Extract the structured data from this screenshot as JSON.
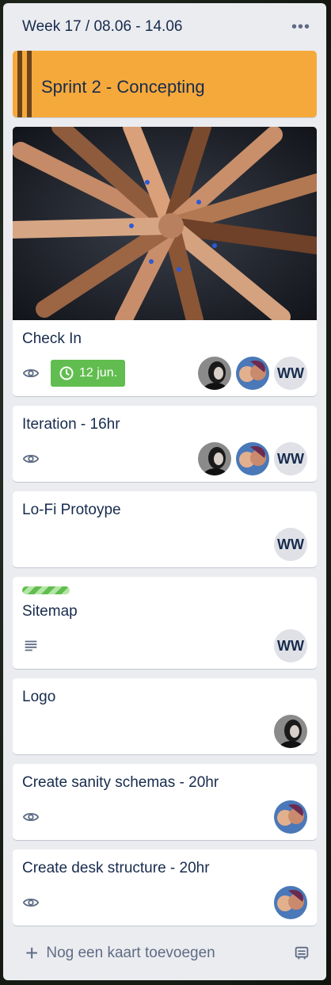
{
  "list": {
    "title": "Week 17 / 08.06 - 14.06",
    "menu_icon": "more-horizontal-icon"
  },
  "banner": {
    "title": "Sprint 2 - Concepting",
    "color": "#f6a93b"
  },
  "cards": [
    {
      "title": "Check In",
      "watching": true,
      "due": "12 jun.",
      "members": [
        "photo-a",
        "photo-b",
        "WW"
      ]
    },
    {
      "title": "Iteration - 16hr",
      "watching": true,
      "members": [
        "photo-a",
        "photo-b",
        "WW"
      ]
    },
    {
      "title": "Lo-Fi Protoype",
      "members": [
        "WW"
      ]
    },
    {
      "title": "Sitemap",
      "has_description": true,
      "label_color": "#61bd4f",
      "members": [
        "WW"
      ]
    },
    {
      "title": "Logo",
      "members": [
        "photo-a"
      ]
    },
    {
      "title": "Create sanity schemas - 20hr",
      "watching": true,
      "members": [
        "photo-b"
      ]
    },
    {
      "title": "Create desk structure - 20hr",
      "watching": true,
      "members": [
        "photo-b"
      ]
    }
  ],
  "member_initials": "WW",
  "footer": {
    "add_label": "Nog een kaart toevoegen",
    "template_icon": "card-template-icon"
  }
}
